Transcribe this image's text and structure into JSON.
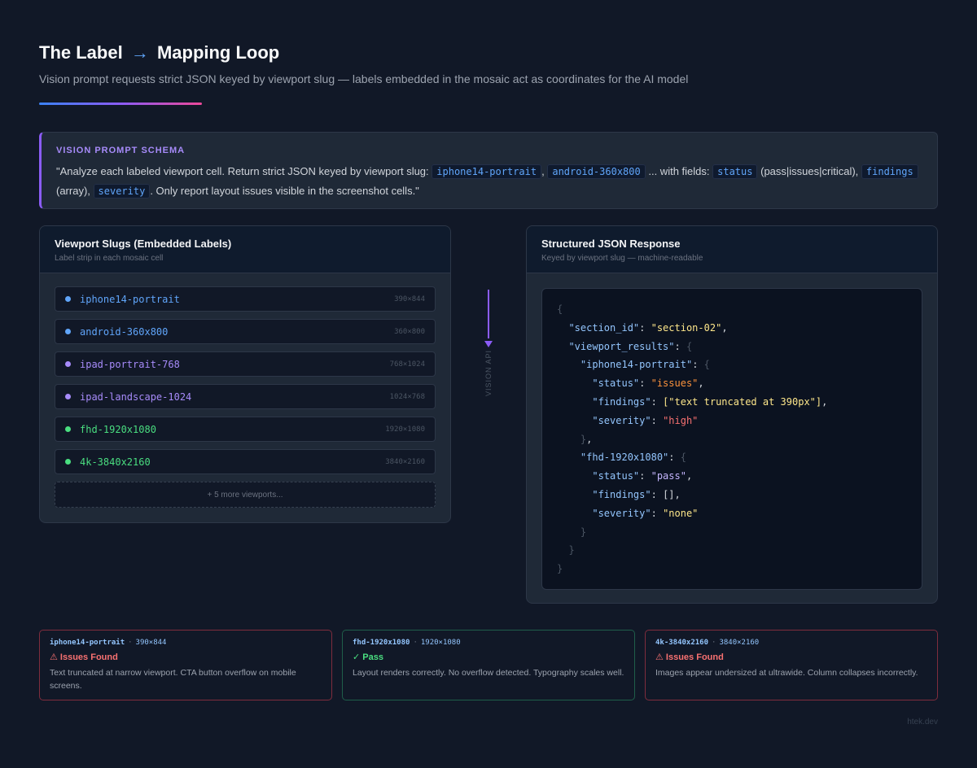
{
  "header": {
    "title_part1": "The Label",
    "title_arrow": "→",
    "title_part2": "Mapping Loop",
    "subtitle": "Vision prompt requests strict JSON keyed by viewport slug — labels embedded in the mosaic act as coordinates for the AI model"
  },
  "schema": {
    "label": "VISION PROMPT SCHEMA",
    "t1": "\"Analyze each labeled viewport cell. Return strict JSON keyed by viewport slug:",
    "c1": "iphone14-portrait",
    "t2": ",",
    "c2": "android-360x800",
    "t3": "... with fields:",
    "c3": "status",
    "t4": "(pass|issues|critical),",
    "c4": "findings",
    "t5": "(array),",
    "c5": "severity",
    "t6": ". Only report layout issues visible in the screenshot cells.\""
  },
  "left_panel": {
    "title": "Viewport Slugs (Embedded Labels)",
    "subtitle": "Label strip in each mosaic cell",
    "slugs": [
      {
        "name": "iphone14-portrait",
        "dims": "390×844",
        "color": "#60a5fa"
      },
      {
        "name": "android-360x800",
        "dims": "360×800",
        "color": "#60a5fa"
      },
      {
        "name": "ipad-portrait-768",
        "dims": "768×1024",
        "color": "#a78bfa"
      },
      {
        "name": "ipad-landscape-1024",
        "dims": "1024×768",
        "color": "#a78bfa"
      },
      {
        "name": "fhd-1920x1080",
        "dims": "1920×1080",
        "color": "#4ade80"
      },
      {
        "name": "4k-3840x2160",
        "dims": "3840×2160",
        "color": "#4ade80"
      }
    ],
    "more": "+ 5 more viewports..."
  },
  "connector": {
    "label": "VISION API"
  },
  "right_panel": {
    "title": "Structured JSON Response",
    "subtitle": "Keyed by viewport slug — machine-readable",
    "json": {
      "open": "{",
      "section_id_key": "\"section_id\"",
      "section_id_val": "\"section-02\"",
      "results_key": "\"viewport_results\"",
      "iphone_key": "\"iphone14-portrait\"",
      "status_key": "\"status\"",
      "issues_val": "\"issues\"",
      "findings_key": "\"findings\"",
      "findings_val": "[\"text truncated at 390px\"]",
      "severity_key": "\"severity\"",
      "high_val": "\"high\"",
      "fhd_key": "\"fhd-1920x1080\"",
      "pass_val": "\"pass\"",
      "empty_arr": "[]",
      "none_val": "\"none\""
    }
  },
  "cards": [
    {
      "slug": "iphone14-portrait",
      "sep": "·",
      "dims": "390×844",
      "status": "⚠ Issues Found",
      "text": "Text truncated at narrow viewport. CTA button overflow on mobile screens."
    },
    {
      "slug": "fhd-1920x1080",
      "sep": "·",
      "dims": "1920×1080",
      "status": "✓ Pass",
      "text": "Layout renders correctly. No overflow detected. Typography scales well."
    },
    {
      "slug": "4k-3840x2160",
      "sep": "·",
      "dims": "3840×2160",
      "status": "⚠ Issues Found",
      "text": "Images appear undersized at ultrawide. Column collapses incorrectly."
    }
  ],
  "footer": "htek.dev"
}
